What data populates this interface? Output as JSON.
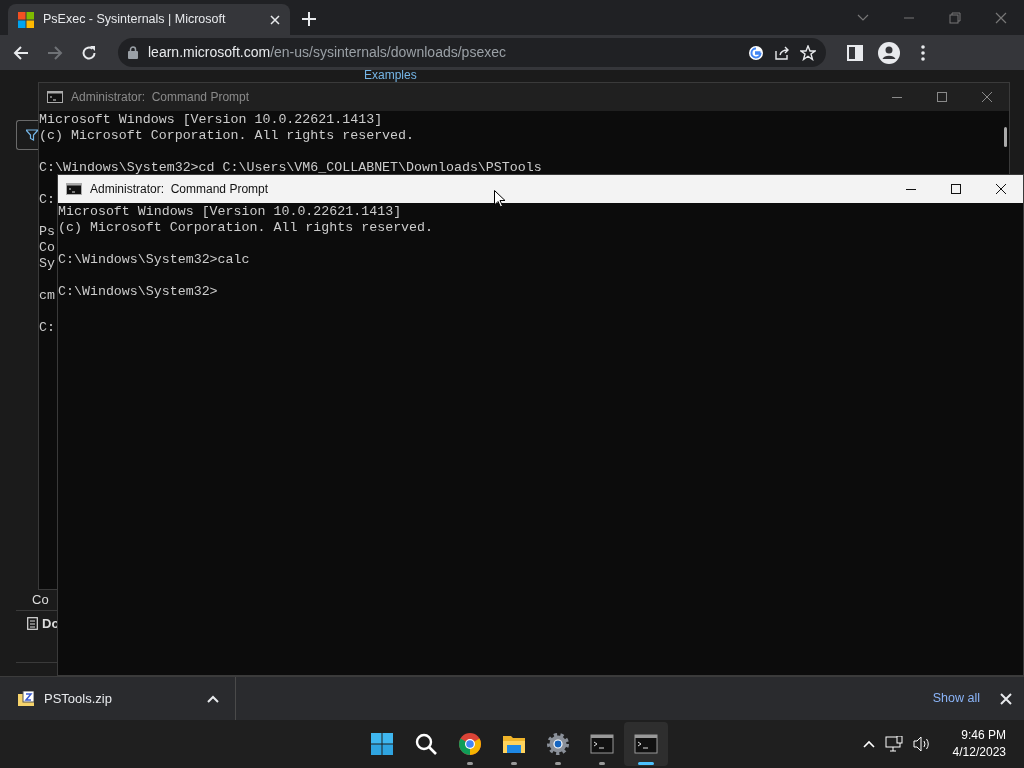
{
  "browser": {
    "tabs": [
      {
        "title": "PsExec - Sysinternals | Microsoft",
        "selected": true
      }
    ],
    "address": {
      "host": "learn.microsoft.com",
      "path": "/en-us/sysinternals/downloads/psexec"
    },
    "forward_disabled": true
  },
  "page": {
    "heading": "Examples",
    "texts": [
      "Co",
      "Do"
    ]
  },
  "windows": [
    {
      "title": "Administrator:  Command Prompt",
      "active": false,
      "blocks": [
        [
          "Microsoft Windows [Version 10.0.22621.1413]",
          "(c) Microsoft Corporation. All rights reserved."
        ],
        [
          "C:\\Windows\\System32>cd C:\\Users\\VM6_COLLABNET\\Downloads\\PSTools"
        ],
        [
          "C:"
        ],
        [
          "Ps",
          "Co",
          "Sy"
        ],
        [
          "cm"
        ],
        [
          "C:"
        ]
      ]
    },
    {
      "title": "Administrator:  Command Prompt",
      "active": true,
      "blocks": [
        [
          "Microsoft Windows [Version 10.0.22621.1413]",
          "(c) Microsoft Corporation. All rights reserved."
        ],
        [
          "C:\\Windows\\System32>calc"
        ],
        [
          "C:\\Windows\\System32>"
        ]
      ]
    }
  ],
  "downloads": {
    "items": [
      {
        "name": "PSTools.zip"
      }
    ],
    "show_all": "Show all"
  },
  "taskbar": {
    "apps": [
      {
        "kind": "start",
        "running": false,
        "selected": false
      },
      {
        "kind": "search",
        "running": false,
        "selected": false
      },
      {
        "kind": "chrome",
        "running": true,
        "selected": false
      },
      {
        "kind": "folder",
        "running": true,
        "selected": false
      },
      {
        "kind": "settings",
        "running": true,
        "selected": false
      },
      {
        "kind": "terminal",
        "running": true,
        "selected": false
      },
      {
        "kind": "terminal",
        "running": true,
        "selected": true
      }
    ],
    "time": "9:46 PM",
    "date": "4/12/2023"
  }
}
